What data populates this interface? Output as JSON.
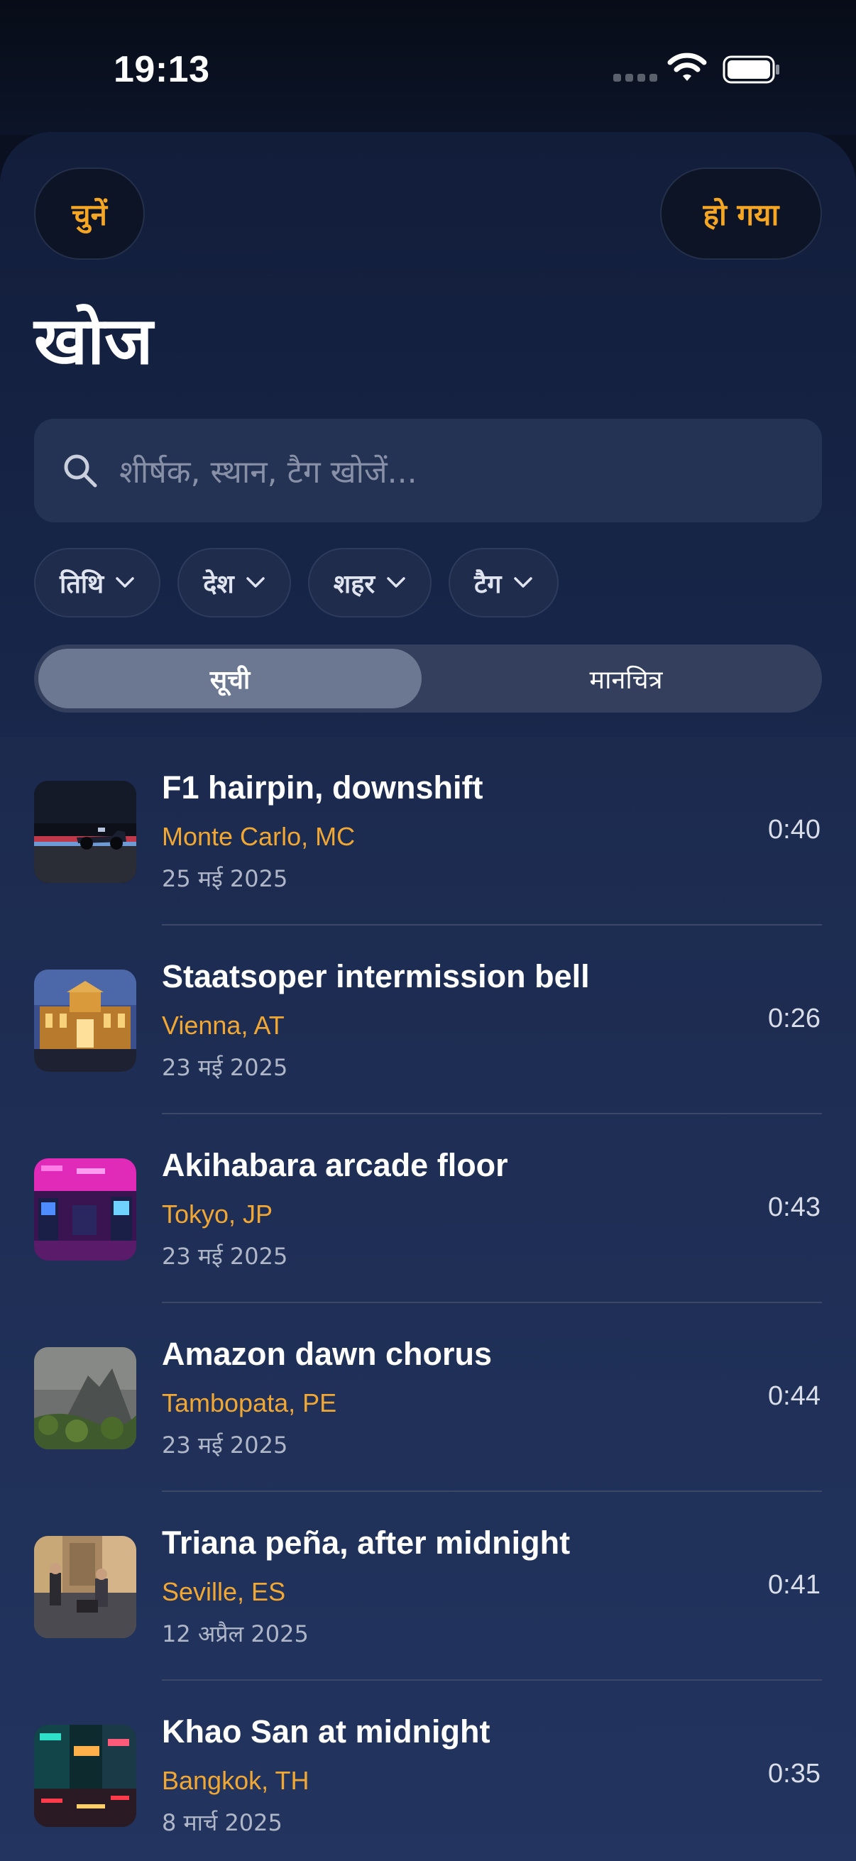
{
  "status_bar": {
    "time": "19:13"
  },
  "header": {
    "select_label": "चुनें",
    "done_label": "हो गया",
    "title": "खोज"
  },
  "search": {
    "placeholder": "शीर्षक, स्थान, टैग खोजें..."
  },
  "filters": [
    {
      "label": "तिथि"
    },
    {
      "label": "देश"
    },
    {
      "label": "शहर"
    },
    {
      "label": "टैग"
    }
  ],
  "view_toggle": {
    "list_label": "सूची",
    "map_label": "मानचित्र",
    "selected": "सूची"
  },
  "recordings": [
    {
      "title": "F1 hairpin, downshift",
      "location": "Monte Carlo, MC",
      "date": "25 मई 2025",
      "duration": "0:40",
      "thumbnail": "racing-car-night"
    },
    {
      "title": "Staatsoper intermission bell",
      "location": "Vienna, AT",
      "date": "23 मई 2025",
      "duration": "0:26",
      "thumbnail": "opera-house-night"
    },
    {
      "title": "Akihabara arcade floor",
      "location": "Tokyo, JP",
      "date": "23 मई 2025",
      "duration": "0:43",
      "thumbnail": "neon-arcade"
    },
    {
      "title": "Amazon dawn chorus",
      "location": "Tambopata, PE",
      "date": "23 मई 2025",
      "duration": "0:44",
      "thumbnail": "misty-rainforest"
    },
    {
      "title": "Triana peña, after midnight",
      "location": "Seville, ES",
      "date": "12 अप्रैल 2025",
      "duration": "0:41",
      "thumbnail": "street-musicians"
    },
    {
      "title": "Khao San at midnight",
      "location": "Bangkok, TH",
      "date": "8 मार्च 2025",
      "duration": "0:35",
      "thumbnail": "neon-street-night"
    }
  ],
  "colors": {
    "accent": "#f5a623",
    "background": "#1c2a4e",
    "location_text": "#f0a733"
  }
}
